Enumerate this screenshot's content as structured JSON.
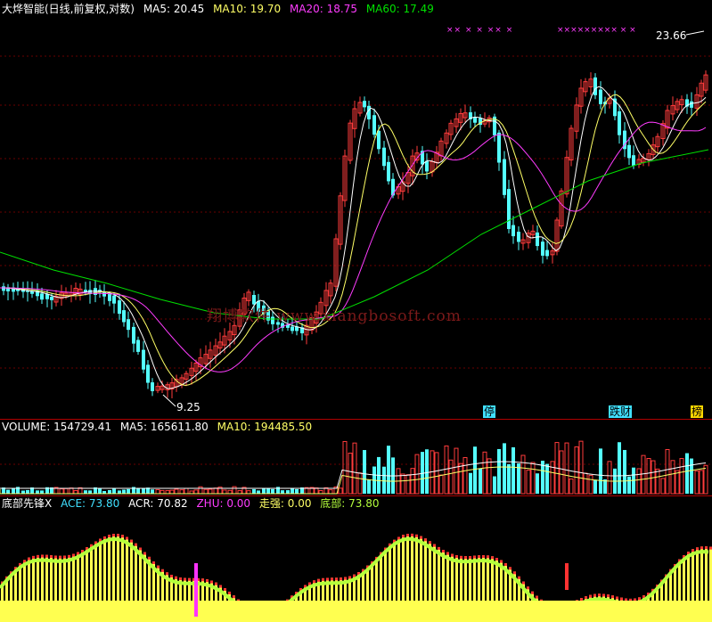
{
  "main": {
    "stock_title": "大烨智能(日线,前复权,对数)",
    "ma5_label": "MA5: 20.45",
    "ma10_label": "MA10: 19.70",
    "ma20_label": "MA20: 18.75",
    "ma60_label": "MA60: 17.49",
    "high_price_label": "23.66",
    "low_price_label": "9.25",
    "watermark": "翔博软件 www.xiangbosoft.com",
    "tag_ting": "停",
    "tag_diecai": "跌财",
    "tag_bang": "榜",
    "x_marker_groups": [
      "××  ×  ×  ××  ×",
      "×××××××××  ×  ×"
    ]
  },
  "volume": {
    "volume_label": "VOLUME: 154729.41",
    "ma5_label": "MA5: 165611.80",
    "ma10_label": "MA10: 194485.50"
  },
  "indicator": {
    "name": "底部先锋X",
    "ace_label": "ACE: 73.80",
    "acr_label": "ACR: 70.82",
    "zhu_label": "ZHU: 0.00",
    "zouqiang_label": "走强: 0.00",
    "dibu_label": "底部: 73.80"
  },
  "colors": {
    "up": "#ff3c3c",
    "down": "#54ffff",
    "ma5": "#ffffff",
    "ma10": "#ffff66",
    "ma20": "#ff3cff",
    "ma60": "#00e000",
    "grid": "#6a0000",
    "bar_yellow": "#ffff50",
    "bar_green": "#b4ff3c",
    "bar_red": "#ff3232",
    "bar_magenta": "#ff32ff"
  }
}
